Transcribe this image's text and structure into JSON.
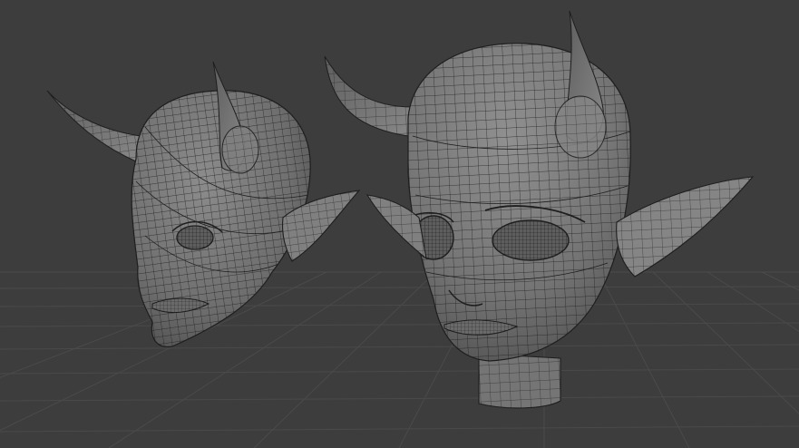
{
  "viewport": {
    "background_color": "#3d3d3d",
    "grid_color": "#4a4a4a",
    "mesh_fill_color": "#7a7a7a",
    "mesh_wire_color": "#1e1e1e",
    "display_mode": "solid-with-wireframe",
    "grid": true
  },
  "objects": [
    {
      "name": "horned-elf-head",
      "view": "three-quarter-left",
      "icon": "mesh-icon"
    },
    {
      "name": "horned-elf-head-with-neck",
      "view": "front-three-quarter",
      "icon": "mesh-icon"
    }
  ]
}
